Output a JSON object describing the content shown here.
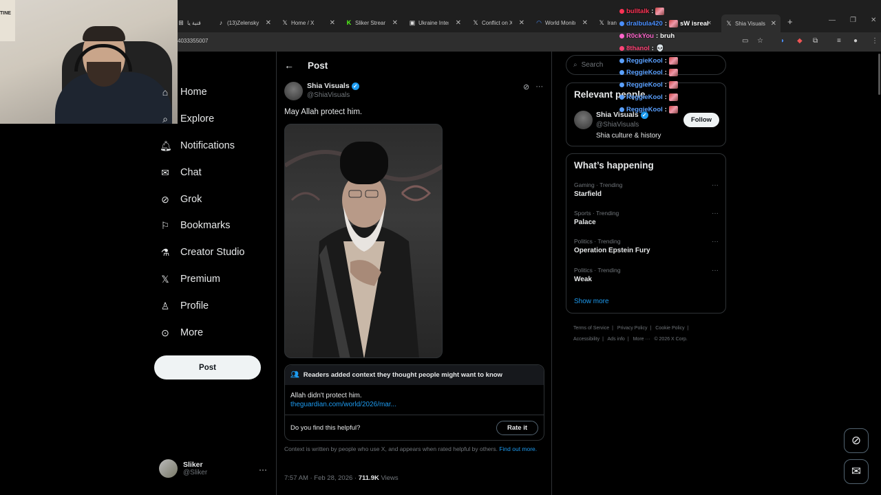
{
  "browser": {
    "tabs": [
      {
        "label": "قنية يا",
        "icon": "⊞"
      },
      {
        "label": "(13)Zelensky",
        "icon": "♪"
      },
      {
        "label": "Home / X",
        "icon": "𝕏"
      },
      {
        "label": "Sliker Stream",
        "icon": "K"
      },
      {
        "label": "Ukraine Interactive",
        "icon": "▣"
      },
      {
        "label": "Conflict on X",
        "icon": "𝕏"
      },
      {
        "label": "World Monitor",
        "icon": "◠"
      },
      {
        "label": "Iran",
        "icon": "𝕏"
      },
      {
        "label": "Shia Visuals",
        "icon": "𝕏"
      }
    ],
    "url_fragment": "4033355007"
  },
  "webcam": {
    "poster_text": "TINE"
  },
  "chat": [
    {
      "user": "bulltalk",
      "message": "",
      "color": "#ff3355",
      "emote": true
    },
    {
      "user": "dralbula420",
      "message": "sW isreal",
      "color": "#4a8fff",
      "emote": true
    },
    {
      "user": "R0ckYou",
      "message": "bruh",
      "color": "#ff66cc",
      "emote": false
    },
    {
      "user": "8thanol",
      "message": "💀",
      "color": "#ff4477",
      "emote": false
    },
    {
      "user": "ReggieKool",
      "message": "",
      "color": "#5aa0ff",
      "emote": true
    },
    {
      "user": "ReggieKool",
      "message": "",
      "color": "#5aa0ff",
      "emote": true
    },
    {
      "user": "ReggieKool",
      "message": "",
      "color": "#5aa0ff",
      "emote": true
    },
    {
      "user": "ReggieKool",
      "message": "",
      "color": "#5aa0ff",
      "emote": true
    },
    {
      "user": "ReggieKool",
      "message": "",
      "color": "#5aa0ff",
      "emote": true
    }
  ],
  "nav": {
    "items": [
      {
        "label": "Home",
        "icon": "home-icon"
      },
      {
        "label": "Explore",
        "icon": "search-icon"
      },
      {
        "label": "Notifications",
        "icon": "bell-icon"
      },
      {
        "label": "Chat",
        "icon": "mail-icon"
      },
      {
        "label": "Grok",
        "icon": "grok-icon"
      },
      {
        "label": "Bookmarks",
        "icon": "bookmark-icon"
      },
      {
        "label": "Creator Studio",
        "icon": "flask-icon"
      },
      {
        "label": "Premium",
        "icon": "x-logo-icon"
      },
      {
        "label": "Profile",
        "icon": "user-icon"
      },
      {
        "label": "More",
        "icon": "more-circle-icon"
      }
    ],
    "post_button": "Post",
    "account": {
      "name": "Sliker",
      "handle": "@Sliker"
    }
  },
  "post": {
    "header_title": "Post",
    "author_name": "Shia Visuals",
    "author_handle": "@ShiaVisuals",
    "text": "May Allah protect him.",
    "community_note": {
      "header": "Readers added context they thought people might want to know",
      "body": "Allah didn't protect him.",
      "link": "theguardian.com/world/2026/mar...",
      "question": "Do you find this helpful?",
      "rate_button": "Rate it",
      "disclaimer": "Context is written by people who use X, and appears when rated helpful by others.",
      "disclaimer_link": "Find out more."
    },
    "time": "7:57 AM · Feb 28, 2026 · ",
    "views_count": "711.9K",
    "views_label": " Views"
  },
  "sidebar": {
    "search_placeholder": "Search",
    "relevant_title": "Relevant people",
    "relevant_person": {
      "name": "Shia Visuals",
      "handle": "@ShiaVisuals",
      "bio": "Shia culture & history",
      "button": "Follow"
    },
    "happening_title": "What’s happening",
    "trends": [
      {
        "category": "Gaming · Trending",
        "name": "Starfield"
      },
      {
        "category": "Sports · Trending",
        "name": "Palace"
      },
      {
        "category": "Politics · Trending",
        "name": "Operation Epstein Fury"
      },
      {
        "category": "Politics · Trending",
        "name": "Weak"
      }
    ],
    "show_more": "Show more",
    "footer": [
      "Terms of Service",
      "|",
      "Privacy Policy",
      "|",
      "Cookie Policy",
      "|",
      "Accessibility",
      "|",
      "Ads info",
      "|",
      "More ···",
      "© 2026 X Corp."
    ]
  },
  "colors": {
    "accent": "#1d9bf0",
    "background": "#000000",
    "border": "#2f3336"
  }
}
